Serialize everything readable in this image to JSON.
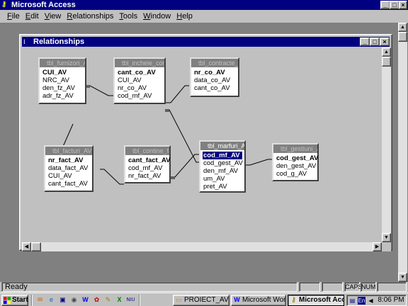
{
  "app": {
    "title": "Microsoft Access",
    "controls": {
      "minimize": "_",
      "maximize": "□",
      "close": "×"
    }
  },
  "menu": [
    "File",
    "Edit",
    "View",
    "Relationships",
    "Tools",
    "Window",
    "Help"
  ],
  "relationships_window": {
    "title": "Relationships",
    "controls": {
      "minimize": "_",
      "maximize": "□",
      "close": "×"
    }
  },
  "tables": {
    "furnizori": {
      "title": "tbl_furnizori_AV",
      "fields": [
        {
          "name": "CUI_AV",
          "pk": true
        },
        {
          "name": "NRC_AV"
        },
        {
          "name": "den_fz_AV"
        },
        {
          "name": "adr_fz_AV"
        }
      ]
    },
    "incheie": {
      "title": "tbl_incheie_con...",
      "fields": [
        {
          "name": "cant_co_AV",
          "pk": true
        },
        {
          "name": "CUI_AV"
        },
        {
          "name": "nr_co_AV"
        },
        {
          "name": "cod_mf_AV"
        }
      ]
    },
    "contracte": {
      "title": "tbl_contracte_AV",
      "fields": [
        {
          "name": "nr_co_AV",
          "pk": true
        },
        {
          "name": "data_co_AV"
        },
        {
          "name": "cant_co_AV"
        }
      ]
    },
    "facturi": {
      "title": "tbl_facturi_AV",
      "fields": [
        {
          "name": "nr_fact_AV",
          "pk": true
        },
        {
          "name": "data_fact_AV"
        },
        {
          "name": "CUI_AV"
        },
        {
          "name": "cant_fact_AV"
        }
      ]
    },
    "contine": {
      "title": "tbl_contine_fact",
      "fields": [
        {
          "name": "cant_fact_AV",
          "pk": true
        },
        {
          "name": "cod_mf_AV"
        },
        {
          "name": "nr_fact_AV"
        }
      ]
    },
    "marfuri": {
      "title": "tbl_marfuri_AV",
      "fields": [
        {
          "name": "cod_mf_AV",
          "pk": true,
          "selected": true
        },
        {
          "name": "cod_gest_AV"
        },
        {
          "name": "den_mf_AV"
        },
        {
          "name": "um_AV"
        },
        {
          "name": "pret_AV"
        }
      ]
    },
    "gestiuni": {
      "title": "tbl_gestiuni_AV",
      "fields": [
        {
          "name": "cod_gest_AV",
          "pk": true
        },
        {
          "name": "den_gest_AV"
        },
        {
          "name": "cod_g_AV"
        }
      ]
    }
  },
  "status": {
    "text": "Ready",
    "caps": "CAPS",
    "num": "NUM"
  },
  "taskbar": {
    "start_label": "Start",
    "quick_launch": [
      "outlook-icon",
      "ie-icon",
      "desktop-icon",
      "channel-icon",
      "word-icon",
      "flower-icon",
      "pen-icon",
      "excel-icon",
      "niu-icon"
    ],
    "tasks": [
      {
        "label": "PROIECT_AV",
        "icon": "folder-icon",
        "pressed": false
      },
      {
        "label": "Microsoft Word ...",
        "icon": "word-icon",
        "pressed": false
      },
      {
        "label": "Microsoft Acc...",
        "icon": "access-key-icon",
        "pressed": true
      }
    ],
    "tray_lang": "En",
    "clock": "8:06 PM"
  },
  "colors": {
    "titlebar": "#000080",
    "face": "#c0c0c0",
    "mdi_bg": "#808080",
    "selection": "#000080"
  }
}
